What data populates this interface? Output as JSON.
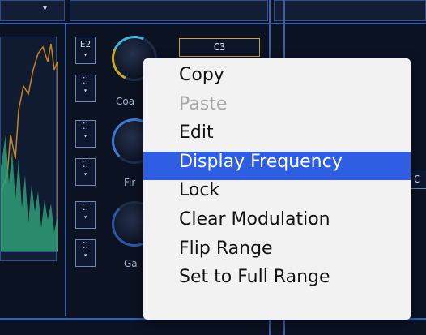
{
  "toolbar": {
    "top_caret": "▾"
  },
  "left_panel": {
    "lfo_selector": "E2"
  },
  "knobs": [
    {
      "label": "Coa",
      "name": "coarse"
    },
    {
      "label": "Fir",
      "name": "fine"
    },
    {
      "label": "Ga",
      "name": "gain"
    }
  ],
  "note_display": {
    "value": "C3"
  },
  "right_partial": {
    "text": "C"
  },
  "context_menu": {
    "items": [
      {
        "label": "Copy",
        "enabled": true
      },
      {
        "label": "Paste",
        "enabled": false
      },
      {
        "label": "Edit",
        "enabled": true
      },
      {
        "label": "Display Frequency",
        "enabled": true,
        "highlighted": true
      },
      {
        "label": "Lock",
        "enabled": true
      },
      {
        "label": "Clear Modulation",
        "enabled": true
      },
      {
        "label": "Flip Range",
        "enabled": true
      },
      {
        "label": "Set to Full Range",
        "enabled": true
      }
    ]
  },
  "colors": {
    "menu_highlight": "#2f5ee5",
    "note_border": "#d6a023",
    "wave_green": "#39b98a",
    "wave_orange": "#c4861d"
  },
  "icons": [
    "dropdown-arrow-icon",
    "step-selector-icon",
    "knob-arc-icon"
  ]
}
